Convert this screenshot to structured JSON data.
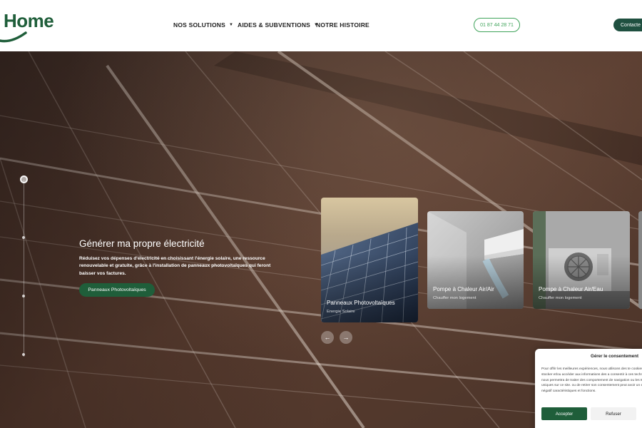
{
  "header": {
    "logo_text": "Home",
    "nav": [
      {
        "label": "NOS SOLUTIONS",
        "has_dropdown": true
      },
      {
        "label": "AIDES & SUBVENTIONS",
        "has_dropdown": true
      },
      {
        "label": "NOTRE HISTOIRE",
        "has_dropdown": false
      }
    ],
    "phone": "01 87 44 28 71",
    "contact_label": "Contacte"
  },
  "hero": {
    "title": "Générer ma propre électricité",
    "description": "Réduisez vos dépenses d'électricité en choisissant l'énergie solaire, une ressource renouvelable et gratuite, grâce à l'installation de panneaux photovoltaïques qui feront baisser vos factures.",
    "cta_label": "Panneaux Photovoltaïques",
    "slider_position": "1 of 4"
  },
  "cards": [
    {
      "title": "Panneaux Photovoltaïques",
      "subtitle": "Energie Solaire"
    },
    {
      "title": "Pompe à Chaleur Air/Air",
      "subtitle": "Chauffer mon logement"
    },
    {
      "title": "Pompe à Chaleur Air/Eau",
      "subtitle": "Chauffer mon logement"
    }
  ],
  "carousel": {
    "prev_icon": "arrow-left-icon",
    "next_icon": "arrow-right-icon"
  },
  "cookie": {
    "title": "Gérer le consentement",
    "text": "Pour offrir les meilleures expériences, nous utilisons des te cookies pour stocker et/ou accéder aux informations des a consentir à ces technologies nous permettra de traiter des comportement de navigation ou les ID uniques sur ce site. ou de retirer son consentement peut avoir un effet négatif caractéristiques et fonctions.",
    "accept_label": "Accepter",
    "refuse_label": "Refuser"
  },
  "colors": {
    "brand_green": "#1f5e3a",
    "phone_green": "#3fa35a",
    "contact_bg": "#1f5040"
  }
}
